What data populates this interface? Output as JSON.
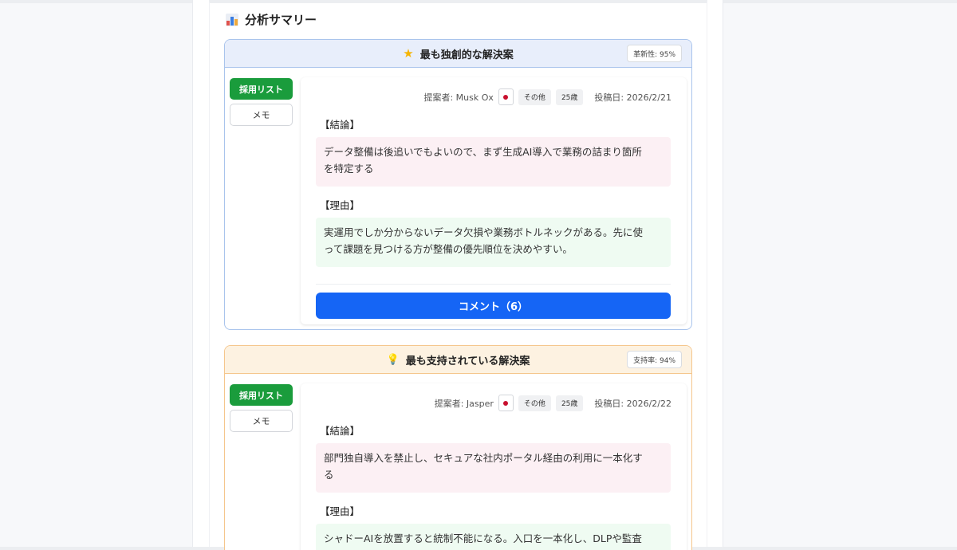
{
  "summary": {
    "title": "分析サマリー",
    "icon": "bar-chart-icon"
  },
  "cards": [
    {
      "title": "最も独創的な解決案",
      "title_icon": "star-icon",
      "badge": "革新性: 95%",
      "adopt_label": "採用リスト",
      "memo_label": "メモ",
      "proposer": "提案者: Musk Ox",
      "flag": "japan-flag",
      "category": "その他",
      "age": "25歳",
      "date": "投稿日: 2026/2/21",
      "conclusion_label": "【結論】",
      "conclusion_line1": "データ整備は後追いでもよいので、まず生成AI導入で業務の詰まり箇所",
      "conclusion_line2": "を特定する",
      "reason_label": "【理由】",
      "reason_line1": "実運用でしか分からないデータ欠損や業務ボトルネックがある。先に使",
      "reason_line2": "って課題を見つける方が整備の優先順位を決めやすい。",
      "comment_label": "コメント（6）"
    },
    {
      "title": "最も支持されている解決案",
      "title_icon": "lightbulb-icon",
      "badge": "支持率: 94%",
      "adopt_label": "採用リスト",
      "memo_label": "メモ",
      "proposer": "提案者: Jasper",
      "flag": "japan-flag",
      "category": "その他",
      "age": "25歳",
      "date": "投稿日: 2026/2/22",
      "conclusion_label": "【結論】",
      "conclusion_line1": "部門独自導入を禁止し、セキュアな社内ポータル経由の利用に一本化す",
      "conclusion_line2": "る",
      "reason_label": "【理由】",
      "reason_line1": "シャドーAIを放置すると統制不能になる。入口を一本化し、DLPや監査"
    }
  ],
  "colors": {
    "adopt_green": "#1a9c3c",
    "comment_blue": "#1565f5",
    "blue_border": "#a9c4ec",
    "orange_border": "#f5c68c"
  }
}
